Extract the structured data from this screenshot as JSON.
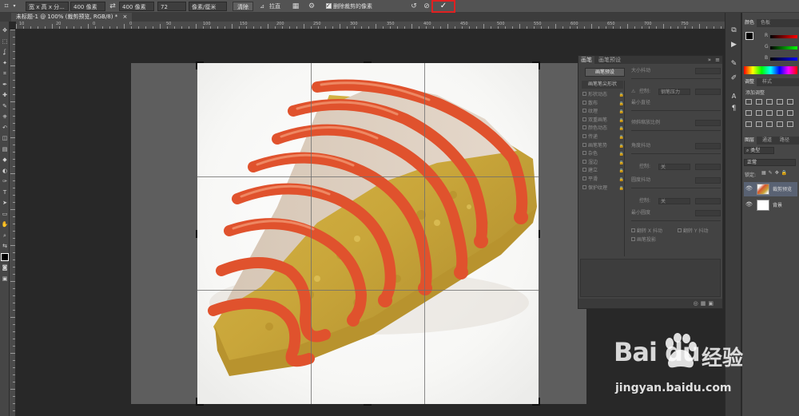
{
  "options_bar": {
    "tool_icon": "crop-icon",
    "ratio_dropdown": "宽 x 高 x 分...",
    "width_value": "400 像素",
    "swap_icon": "swap-arrows-icon",
    "height_value": "400 像素",
    "resolution_value": "72",
    "unit_dropdown": "像素/厘米",
    "clear_label": "清除",
    "straighten_icon": "straighten-icon",
    "straighten_label": "拉直",
    "grid_icon": "grid-overlay-icon",
    "settings_icon": "gear-icon",
    "delete_cropped_label": "删除裁剪的像素",
    "delete_cropped_checked": true,
    "reset_icon": "reset-icon",
    "cancel_icon": "cancel-circle-icon",
    "commit_icon": "checkmark-icon",
    "commit_symbol": "✓",
    "commit_highlight_color": "#e02020"
  },
  "document_tab": {
    "title": "未标题-1 @ 100% (裁剪预览, RGB/8) *",
    "close_symbol": "×"
  },
  "ruler": {
    "top_labels": [
      "10",
      "20",
      "0",
      "0",
      "50",
      "100",
      "150",
      "200",
      "250",
      "300",
      "350",
      "400",
      "450",
      "500",
      "550",
      "600",
      "650",
      "700",
      "750"
    ]
  },
  "toolbar": {
    "tools": [
      "move-icon",
      "marquee-icon",
      "lasso-icon",
      "quick-select-icon",
      "crop-icon",
      "eyedropper-icon",
      "healing-icon",
      "brush-icon",
      "clone-stamp-icon",
      "history-brush-icon",
      "eraser-icon",
      "gradient-icon",
      "blur-icon",
      "dodge-icon",
      "pen-icon",
      "type-icon",
      "path-select-icon",
      "shape-icon",
      "hand-icon",
      "zoom-icon",
      "swap-colors-icon",
      "color-swatch-icon",
      "quick-mask-icon",
      "screen-mode-icon"
    ]
  },
  "brush_panel": {
    "tabs": [
      "画笔",
      "画笔预设"
    ],
    "preset_button": "画笔预设",
    "shape_header": "画笔笔尖形状",
    "options": [
      "形状动态",
      "散布",
      "纹理",
      "双重画笔",
      "颜色动态",
      "传递",
      "画笔笔势",
      "杂色",
      "湿边",
      "建立",
      "平滑",
      "保护纹理"
    ],
    "size_jitter": "大小抖动",
    "control_label": "控制:",
    "control_pen_pressure": "钢笔压力",
    "min_diameter": "最小直径",
    "tilt_scale": "倾斜缩放比例",
    "angle_jitter": "角度抖动",
    "control_off": "关",
    "roundness_jitter": "圆度抖动",
    "min_roundness": "最小圆度",
    "flip_x": "翻转 X 抖动",
    "flip_y": "翻转 Y 抖动",
    "brush_projection": "画笔投影"
  },
  "color_panel": {
    "tabs": [
      "颜色",
      "色板"
    ],
    "labels": [
      "R",
      "G",
      "B"
    ]
  },
  "adjust_panel": {
    "tabs": [
      "调整",
      "样式"
    ],
    "add_label": "添加调整"
  },
  "layers_panel": {
    "tabs": [
      "图层",
      "通道",
      "路径"
    ],
    "kind_filter": "类型",
    "blend_mode": "正常",
    "lock_label": "锁定:",
    "layers": [
      {
        "name": "裁剪预览",
        "visible": true
      },
      {
        "name": "背景",
        "visible": true
      }
    ]
  },
  "watermark": {
    "brand": "Bai du",
    "cn": "经验",
    "url": "jingyan.baidu.com"
  }
}
